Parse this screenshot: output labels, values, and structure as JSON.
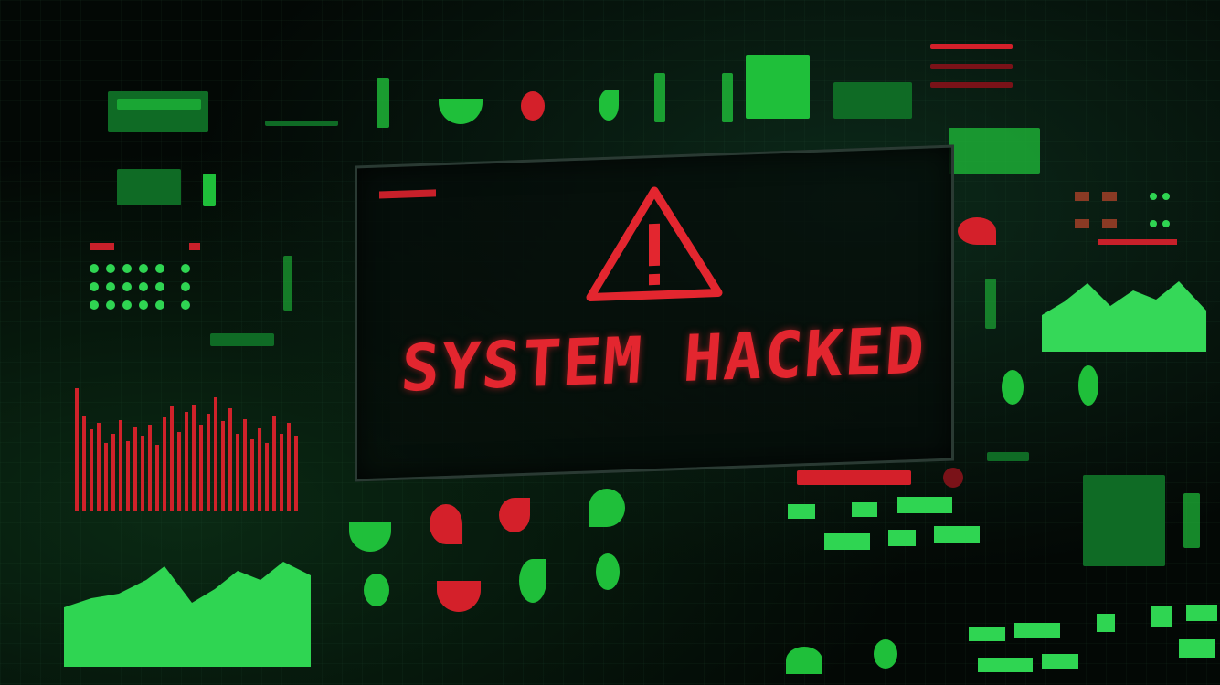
{
  "headline": "SYSTEM HACKED",
  "icons": {
    "warning": "warning-triangle-icon"
  },
  "colors": {
    "background": "#030805",
    "alert_red": "#e3262f",
    "hud_green": "#1fbf3a"
  }
}
